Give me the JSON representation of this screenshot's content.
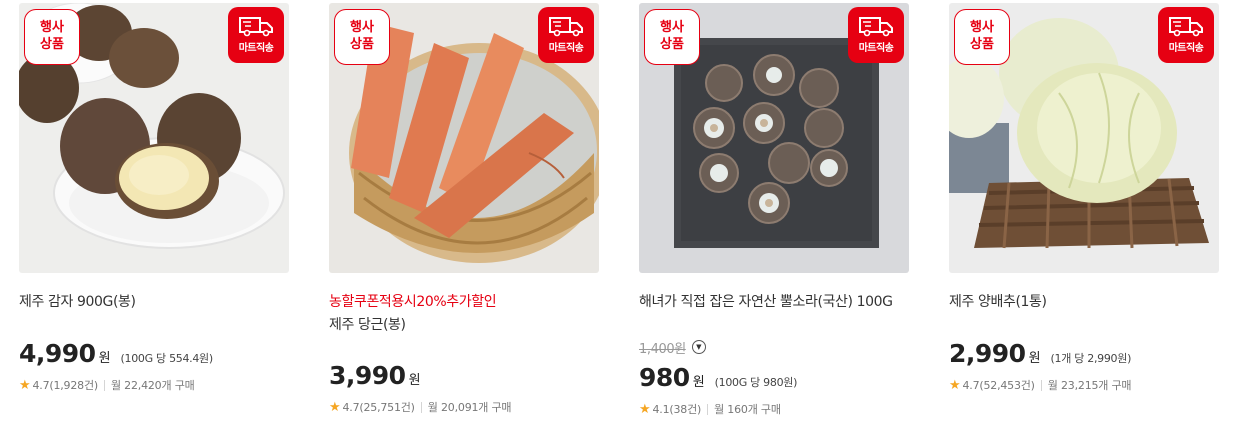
{
  "badges": {
    "event_line1": "행사",
    "event_line2": "상품",
    "delivery": "마트직송"
  },
  "products": [
    {
      "name": "제주 감자 900G(봉)",
      "promo": "",
      "original_price": "",
      "price": "4,990",
      "won": "원",
      "unit_price": "(100G 당 554.4원)",
      "rating": "4.7",
      "reviews": "(1,928건)",
      "monthly": "월 22,420개 구매",
      "image": "jeju-potato-photo"
    },
    {
      "name": "제주 당근(봉)",
      "promo": "농할쿠폰적용시20%추가할인",
      "original_price": "",
      "price": "3,990",
      "won": "원",
      "unit_price": "",
      "rating": "4.7",
      "reviews": "(25,751건)",
      "monthly": "월 20,091개 구매",
      "image": "jeju-carrot-photo"
    },
    {
      "name": "해녀가 직접 잡은 자연산 뿔소라(국산) 100G",
      "promo": "",
      "original_price": "1,400원",
      "price": "980",
      "won": "원",
      "unit_price": "(100G 당 980원)",
      "rating": "4.1",
      "reviews": "(38건)",
      "monthly": "월 160개 구매",
      "image": "turban-shell-photo"
    },
    {
      "name": "제주 양배추(1통)",
      "promo": "",
      "original_price": "",
      "price": "2,990",
      "won": "원",
      "unit_price": "(1개 당 2,990원)",
      "rating": "4.7",
      "reviews": "(52,453건)",
      "monthly": "월 23,215개 구매",
      "image": "jeju-cabbage-photo"
    }
  ],
  "colors": {
    "brand_red": "#e60012",
    "star": "#f5a623"
  }
}
